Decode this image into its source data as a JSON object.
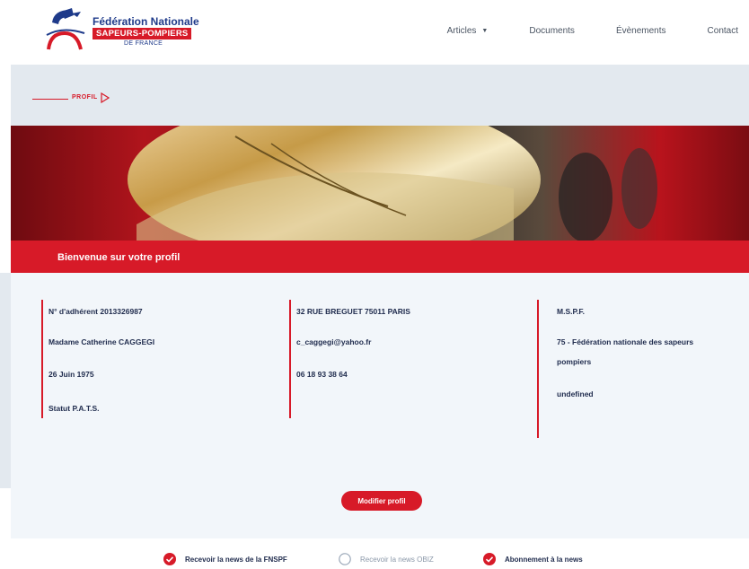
{
  "logo": {
    "line1": "Fédération Nationale",
    "line2": "SAPEURS-POMPIERS",
    "line3": "DE FRANCE"
  },
  "nav": {
    "items": [
      {
        "label": "Articles",
        "dropdown": true
      },
      {
        "label": "Documents"
      },
      {
        "label": "Évènements"
      },
      {
        "label": "Contact"
      }
    ]
  },
  "breadcrumb": {
    "label": "PROFIL"
  },
  "profile": {
    "title": "Bienvenue sur votre profil",
    "col1": [
      "N° d'adhérent 2013326987",
      "Madame  Catherine  CAGGEGI",
      "26 Juin 1975",
      "Statut P.A.T.S."
    ],
    "col2": [
      "32 RUE BREGUET 75011 PARIS",
      "c_caggegi@yahoo.fr",
      "06 18 93 38 64"
    ],
    "col3": [
      "M.S.P.F.",
      "75 - Fédération nationale des sapeurs",
      "pompiers",
      "undefined"
    ],
    "edit_button": "Modifier profil"
  },
  "newsletters": [
    {
      "label": "Recevoir la news de la FNSPF",
      "checked": true
    },
    {
      "label": "Recevoir la news OBIZ",
      "checked": false
    },
    {
      "label": "Abonnement à la news",
      "checked": true
    }
  ],
  "colors": {
    "brand_red": "#d71a28",
    "brand_blue": "#1e3a8a",
    "text_dark": "#1f2b4d",
    "panel_bg": "#f2f6fa"
  }
}
